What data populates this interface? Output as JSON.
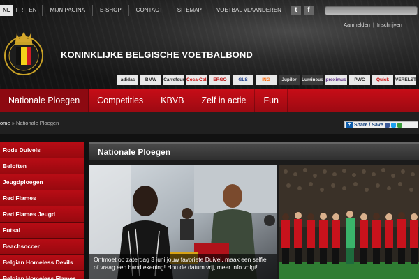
{
  "languages": [
    {
      "code": "NL",
      "active": true
    },
    {
      "code": "FR",
      "active": false
    },
    {
      "code": "EN",
      "active": false
    }
  ],
  "top_links": [
    "MIJN PAGINA",
    "E-SHOP",
    "CONTACT",
    "SITEMAP",
    "VOETBAL VLAANDEREN"
  ],
  "social": {
    "twitter": "t",
    "facebook": "f"
  },
  "auth": {
    "login": "Aanmelden",
    "separator": "|",
    "register": "Inschrijven"
  },
  "brand": {
    "name": "KONINKLIJKE BELGISCHE VOETBALBOND",
    "crest_text": "URBSFA KBVB",
    "crest_year": "1895"
  },
  "sponsors": [
    "adidas",
    "BMW",
    "Carrefour",
    "Coca-Cola",
    "ERGO",
    "GLS",
    "ING",
    "Jupiler",
    "Lumineus",
    "proximus",
    "PWC",
    "Quick",
    "VERELST"
  ],
  "nav": {
    "items": [
      "Nationale Ploegen",
      "Competities",
      "KBVB",
      "Zelf in actie",
      "Fun"
    ],
    "active_index": 0
  },
  "breadcrumb": {
    "home": "ome",
    "separator": " » ",
    "current": "Nationale Ploegen"
  },
  "share": {
    "label": "Share / Save"
  },
  "sidebar": {
    "items": [
      "Rode Duivels",
      "Beloften",
      "Jeugdploegen",
      "Red Flames",
      "Red Flames Jeugd",
      "Futsal",
      "Beachsoccer",
      "Belgian Homeless Devils",
      "Belgian Homeless Flames"
    ]
  },
  "content": {
    "title": "Nationale Ploegen",
    "caption": "Ontmoet op zaterdag 3 juni jouw favoriete Duivel, maak een selfie of vraag een handtekening! Hou de datum vrij, meer info volgt!"
  },
  "colors": {
    "accent_red": "#c70d17",
    "nav_dark_red": "#8d0911",
    "header_dark": "#1a1a1a"
  }
}
